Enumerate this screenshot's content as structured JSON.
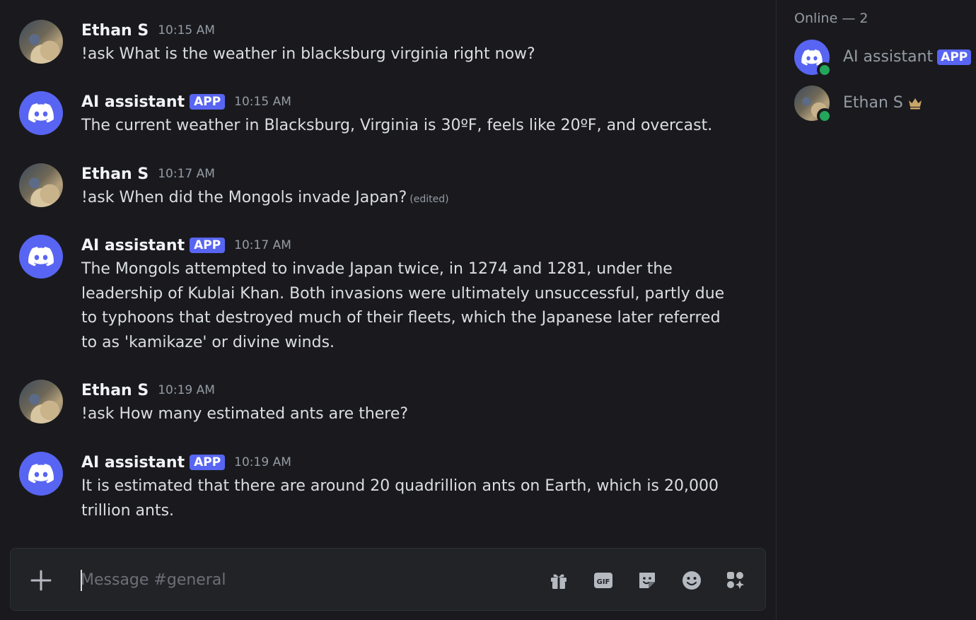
{
  "messages": [
    {
      "author": "Ethan S",
      "time": "10:15 AM",
      "text": "!ask What is the weather in blacksburg virginia right now?"
    },
    {
      "author": "AI assistant",
      "badge": "APP",
      "time": "10:15 AM",
      "text": "The current weather in Blacksburg, Virginia is 30ºF, feels like 20ºF, and overcast."
    },
    {
      "author": "Ethan S",
      "time": "10:17 AM",
      "text": "!ask When did the Mongols invade Japan?",
      "edited": "(edited)"
    },
    {
      "author": "AI assistant",
      "badge": "APP",
      "time": "10:17 AM",
      "text": "The Mongols attempted to invade Japan twice, in 1274 and 1281, under the leadership of Kublai Khan. Both invasions were ultimately unsuccessful, partly due to typhoons that destroyed much of their fleets, which the Japanese later referred to as 'kamikaze' or divine winds."
    },
    {
      "author": "Ethan S",
      "time": "10:19 AM",
      "text": "!ask How many estimated ants are there?"
    },
    {
      "author": "AI assistant",
      "badge": "APP",
      "time": "10:19 AM",
      "text": "It is estimated that there are around 20 quadrillion ants on Earth, which is 20,000 trillion ants."
    }
  ],
  "composer": {
    "placeholder": "Message #general",
    "icons": [
      "plus-icon",
      "gift-icon",
      "gif-icon",
      "sticker-icon",
      "emoji-icon",
      "apps-icon"
    ]
  },
  "members": {
    "header": "Online — 2",
    "list": [
      {
        "name": "AI assistant",
        "badge": "APP",
        "status": "online"
      },
      {
        "name": "Ethan S",
        "status": "online",
        "owner_icon": "crown-icon"
      }
    ]
  },
  "colors": {
    "accent": "#5865f2",
    "online": "#23a55a",
    "background": "#1a1a1e",
    "crown": "#c9a567"
  }
}
